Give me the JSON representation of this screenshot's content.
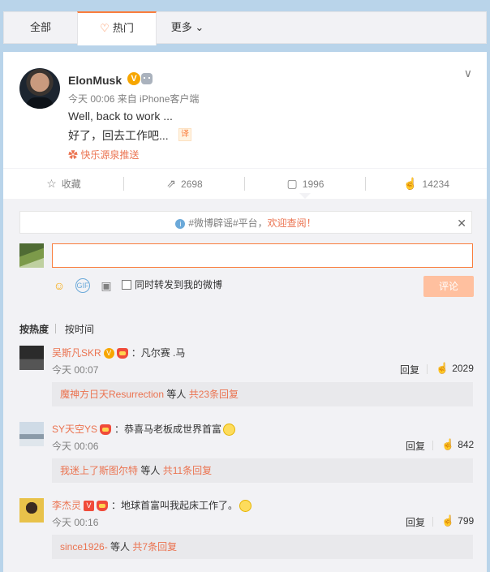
{
  "tabs": [
    {
      "label": "全部"
    },
    {
      "label": "热门"
    },
    {
      "label": "更多"
    }
  ],
  "post": {
    "username": "ElonMusk",
    "verified_icon": "V",
    "meta": "今天 00:06 来自 iPhone客户端",
    "text": "Well, back to work ...",
    "translation": "好了，回去工作吧...",
    "translate_icon": "译",
    "source_tag": "快乐源泉推送"
  },
  "actions": {
    "favorite": "收藏",
    "repost": "2698",
    "comment": "1996",
    "like": "14234"
  },
  "notice": {
    "prefix": "#微博辟谣#平台，",
    "highlight": "欢迎查阅！"
  },
  "composer": {
    "placeholder": "",
    "also_repost": "同时转发到我的微博",
    "submit": "评论"
  },
  "sort": {
    "hot": "按热度",
    "time": "按时间"
  },
  "comments": [
    {
      "name": "吴斯凡SKR",
      "text": "：凡尔赛 .马",
      "time": "今天 00:07",
      "reply": "回复",
      "likes": "2029",
      "sub_user": "魔神方日天Resurrection",
      "sub_mid": " 等人 ",
      "sub_count": "共23条回复"
    },
    {
      "name": "SY天空YS",
      "text": "：恭喜马老板成世界首富",
      "time": "今天 00:06",
      "reply": "回复",
      "likes": "842",
      "sub_user": "我迷上了斯图尔特",
      "sub_mid": " 等人 ",
      "sub_count": "共11条回复"
    },
    {
      "name": "李杰灵",
      "text": "：地球首富叫我起床工作了。",
      "time": "今天 00:16",
      "reply": "回复",
      "likes": "799",
      "sub_user": "since1926-",
      "sub_mid": " 等人 ",
      "sub_count": "共7条回复"
    }
  ],
  "colors": {
    "accent": "#fa7d3c",
    "link": "#eb7350",
    "muted": "#808080",
    "verified": "#f7a600"
  }
}
